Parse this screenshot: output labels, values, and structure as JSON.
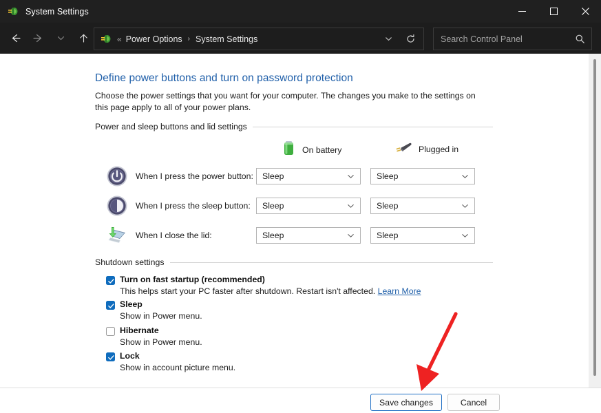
{
  "window": {
    "title": "System Settings",
    "icon": "system-settings-icon",
    "controls": {
      "minimize": "minimize-icon",
      "maximize": "maximize-icon",
      "close": "close-icon"
    }
  },
  "nav": {
    "back": "back-arrow-icon",
    "forward": "forward-arrow-icon",
    "recent": "chevron-down-icon",
    "up": "up-arrow-icon",
    "address": {
      "icon": "system-settings-icon",
      "overflow": "«",
      "crumbs": [
        "Power Options",
        "System Settings"
      ],
      "separator": "›",
      "dropdown": "chevron-down-icon",
      "refresh": "refresh-icon"
    },
    "search": {
      "placeholder": "Search Control Panel",
      "value": "",
      "icon": "search-icon"
    }
  },
  "main": {
    "title": "Define power buttons and turn on password protection",
    "description": "Choose the power settings that you want for your computer. The changes you make to the settings on this page apply to all of your power plans.",
    "groups": [
      {
        "label": "Power and sleep buttons and lid settings"
      },
      {
        "label": "Shutdown settings"
      }
    ],
    "columns": [
      {
        "label": "On battery",
        "icon": "battery-icon"
      },
      {
        "label": "Plugged in",
        "icon": "power-plug-icon"
      }
    ],
    "settings_rows": [
      {
        "icon": "power-button-icon",
        "label": "When I press the power button:",
        "on_battery": "Sleep",
        "plugged_in": "Sleep"
      },
      {
        "icon": "sleep-button-icon",
        "label": "When I press the sleep button:",
        "on_battery": "Sleep",
        "plugged_in": "Sleep"
      },
      {
        "icon": "close-lid-icon",
        "label": "When I close the lid:",
        "on_battery": "Sleep",
        "plugged_in": "Sleep"
      }
    ],
    "shutdown_options": [
      {
        "checked": true,
        "title": "Turn on fast startup (recommended)",
        "description": "This helps start your PC faster after shutdown. Restart isn't affected.",
        "link": "Learn More"
      },
      {
        "checked": true,
        "title": "Sleep",
        "description": "Show in Power menu.",
        "link": ""
      },
      {
        "checked": false,
        "title": "Hibernate",
        "description": "Show in Power menu.",
        "link": ""
      },
      {
        "checked": true,
        "title": "Lock",
        "description": "Show in account picture menu.",
        "link": ""
      }
    ]
  },
  "footer": {
    "save_label": "Save changes",
    "cancel_label": "Cancel"
  },
  "annotation": {
    "type": "red-arrow-pointer",
    "color": "#ee2222",
    "points_to": "save-changes-button"
  },
  "colors": {
    "titlebar_bg": "#202020",
    "navbar_bg": "#1d1d1d",
    "content_bg": "#ffffff",
    "link_blue": "#1f5fa9",
    "checkbox_blue": "#0f6cbd",
    "primary_border": "#1f6fc4"
  }
}
